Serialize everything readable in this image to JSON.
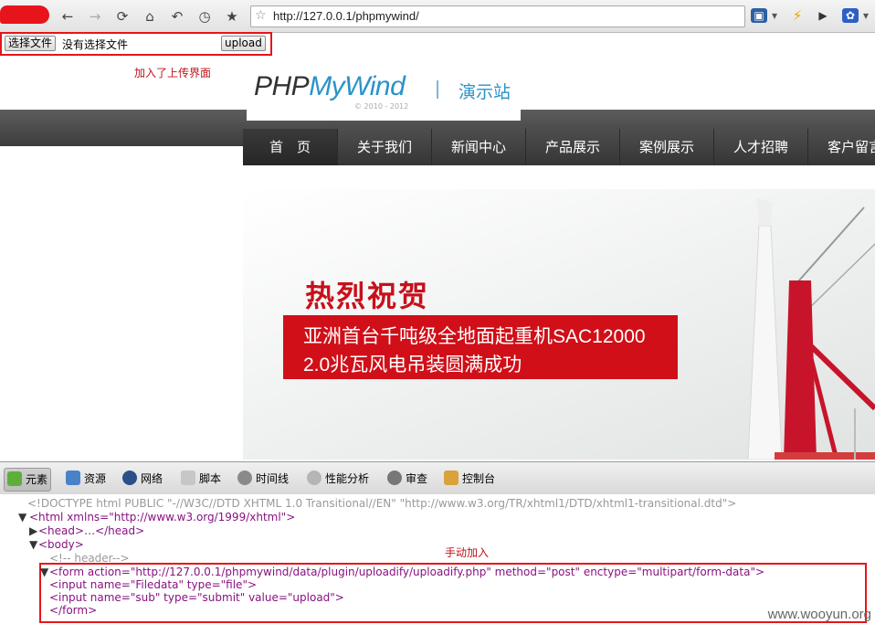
{
  "browser": {
    "url": "http://127.0.0.1/phpmywind/",
    "icons": [
      "back-icon",
      "forward-icon",
      "reload-icon",
      "home-icon",
      "undo-icon",
      "history-icon",
      "bookmark-star-icon"
    ]
  },
  "upload_form": {
    "choose_button": "选择文件",
    "no_file_text": "没有选择文件",
    "upload_button": "upload",
    "annotation": "加入了上传界面"
  },
  "site": {
    "logo_part1": "PHP",
    "logo_part2": "MyWind",
    "copyright": "© 2010 - 2012",
    "subtitle": "演示站",
    "nav": [
      "首　页",
      "关于我们",
      "新闻中心",
      "产品展示",
      "案例展示",
      "人才招聘",
      "客户留言"
    ]
  },
  "banner": {
    "headline": "热烈祝贺",
    "line1": "亚洲首台千吨级全地面起重机SAC12000",
    "line2": "2.0兆瓦风电吊装圆满成功"
  },
  "devtools": {
    "tabs": [
      "元素",
      "资源",
      "网络",
      "脚本",
      "时间线",
      "性能分析",
      "审查",
      "控制台"
    ],
    "annotation": "手动加入",
    "lines": {
      "doctype": "<!DOCTYPE html PUBLIC \"-//W3C//DTD XHTML 1.0 Transitional//EN\" \"http://www.w3.org/TR/xhtml1/DTD/xhtml1-transitional.dtd\">",
      "html": "<html xmlns=\"http://www.w3.org/1999/xhtml\">",
      "head": "<head>…</head>",
      "body": "<body>",
      "comment": "<!-- header-->",
      "form": "<form action=\"http://127.0.0.1/phpmywind/data/plugin/uploadify/uploadify.php\" method=\"post\" enctype=\"multipart/form-data\">",
      "input1": "<input name=\"Filedata\" type=\"file\">",
      "input2": "<input name=\"sub\" type=\"submit\" value=\"upload\">",
      "form_close": "</form>"
    }
  },
  "watermark": "www.wooyun.org",
  "colors": {
    "annotation_red": "#e8141b",
    "brand_blue": "#2a93c9",
    "banner_red": "#d00f18"
  }
}
